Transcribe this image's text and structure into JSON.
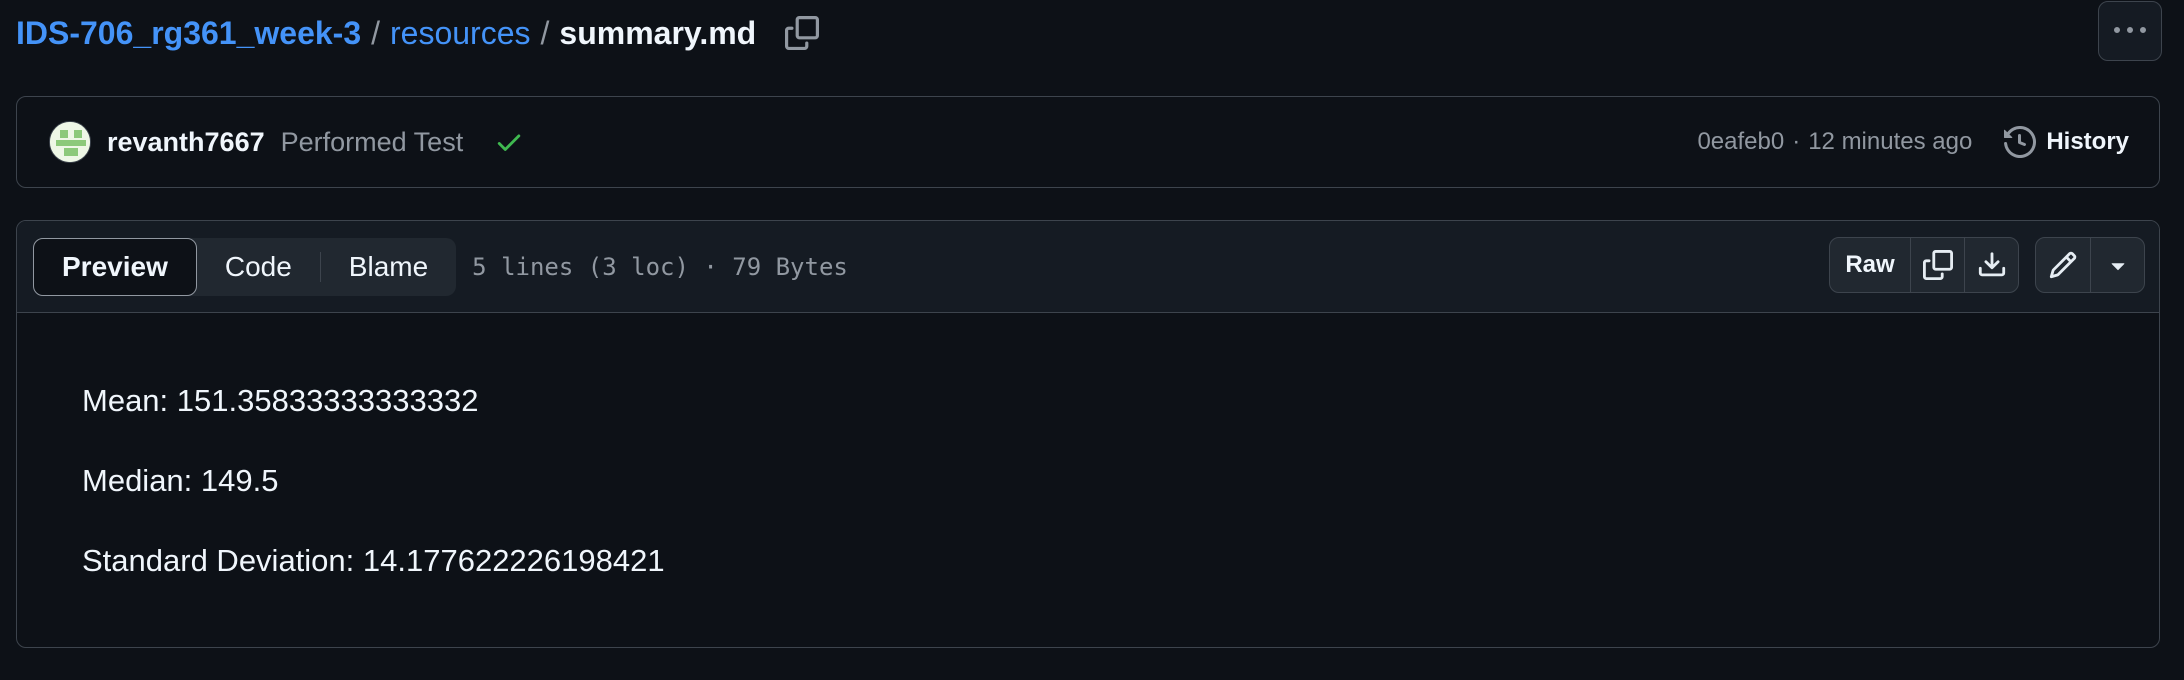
{
  "breadcrumb": {
    "repo": "IDS-706_rg361_week-3",
    "separator": "/",
    "folder": "resources",
    "file": "summary.md"
  },
  "commit": {
    "author": "revanth7667",
    "message": "Performed Test",
    "sha": "0eafeb0",
    "dot": "·",
    "time": "12 minutes ago",
    "history_label": "History",
    "status_color": "#3fb950"
  },
  "file_header": {
    "tabs": [
      "Preview",
      "Code",
      "Blame"
    ],
    "active_tab": "Preview",
    "meta": "5 lines (3 loc) · 79 Bytes",
    "raw_label": "Raw"
  },
  "content": {
    "lines": [
      "Mean: 151.35833333333332",
      "Median: 149.5",
      "Standard Deviation: 14.177622226198421"
    ]
  },
  "colors": {
    "background": "#0d1117",
    "link": "#4493f8",
    "border": "#3d444d",
    "muted": "#9198a1"
  }
}
